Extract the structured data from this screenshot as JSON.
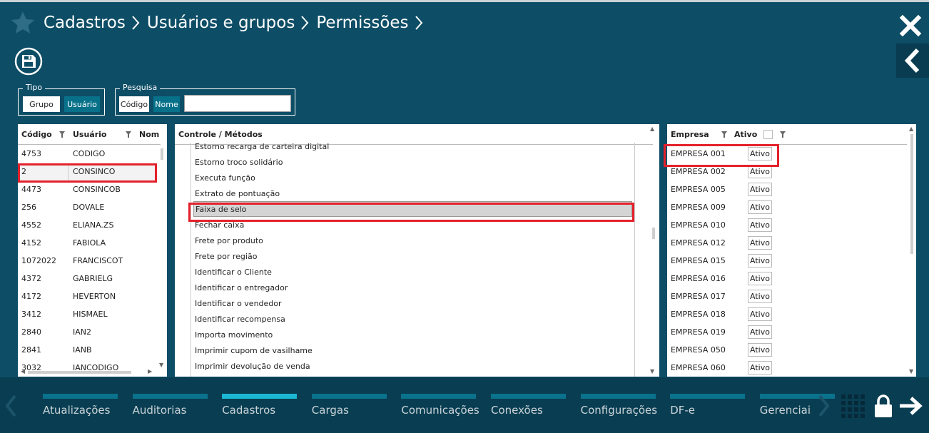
{
  "header": {
    "breadcrumb": [
      "Cadastros",
      "Usuários e grupos",
      "Permissões"
    ]
  },
  "filters": {
    "tipo": {
      "legend": "Tipo",
      "options": [
        "Grupo",
        "Usuário"
      ],
      "selected": "Usuário"
    },
    "pesquisa": {
      "legend": "Pesquisa",
      "options": [
        "Código",
        "Nome"
      ],
      "selected": "Nome",
      "value": ""
    }
  },
  "users": {
    "columns": [
      "Código",
      "Usuário",
      "Nom"
    ],
    "rows": [
      [
        "4753",
        "CODIGO"
      ],
      [
        "2",
        "CONSINCO"
      ],
      [
        "4473",
        "CONSINCOB"
      ],
      [
        "256",
        "DOVALE"
      ],
      [
        "4552",
        "ELIANA.ZS"
      ],
      [
        "4152",
        "FABIOLA"
      ],
      [
        "1072022",
        "FRANCISCOT"
      ],
      [
        "4372",
        "GABRIELG"
      ],
      [
        "4172",
        "HEVERTON"
      ],
      [
        "3412",
        "HISMAEL"
      ],
      [
        "2840",
        "IAN2"
      ],
      [
        "2841",
        "IANB"
      ],
      [
        "3032",
        "IANCODIGO"
      ]
    ],
    "selected_index": 1
  },
  "controls": {
    "column": "Controle / Métodos",
    "items": [
      "Estorno recarga de carteira digital",
      "Estorno troco solidário",
      "Executa função",
      "Extrato de pontuação",
      "Faixa de selo",
      "Fechar caixa",
      "Frete por produto",
      "Frete por região",
      "Identificar o Cliente",
      "Identificar o entregador",
      "Identificar o vendedor",
      "Identificar recompensa",
      "Importa movimento",
      "Imprimir cupom de vasilhame",
      "Imprimir devolução de venda"
    ],
    "selected_index": 4
  },
  "empresas": {
    "columns": [
      "Empresa",
      "Ativo"
    ],
    "button_label": "Ativo",
    "rows": [
      "EMPRESA 001",
      "EMPRESA 002",
      "EMPRESA 005",
      "EMPRESA 009",
      "EMPRESA 010",
      "EMPRESA 012",
      "EMPRESA 015",
      "EMPRESA 016",
      "EMPRESA 017",
      "EMPRESA 018",
      "EMPRESA 019",
      "EMPRESA 050",
      "EMPRESA 060"
    ]
  },
  "bottom_nav": {
    "items": [
      "Atualizações",
      "Auditorias",
      "Cadastros",
      "Cargas",
      "Comunicações",
      "Conexões",
      "Configurações",
      "DF-e",
      "Gerenciais"
    ],
    "active": "Cadastros"
  },
  "colors": {
    "background": "#0d4d66",
    "bottom_bar": "#093e52",
    "nav_bar": "#0a728c",
    "nav_bar_active": "#1bb7d3",
    "highlight": "#e3212b",
    "selected_button": "#08718a"
  }
}
